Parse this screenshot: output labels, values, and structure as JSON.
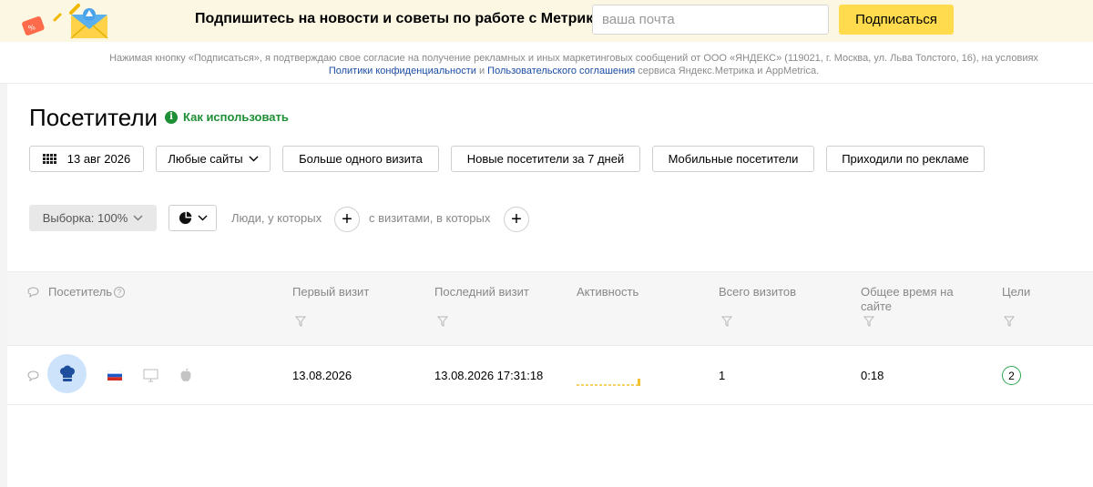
{
  "banner": {
    "title": "Подпишитесь на новости и советы по работе с Метрикой",
    "email_placeholder": "ваша почта",
    "subscribe_label": "Подписаться",
    "consent_line1": "Нажимая кнопку «Подписаться», я подтверждаю свое согласие на получение рекламных и иных маркетинговых сообщений от ООО «ЯНДЕКС» (119021, г. Москва, ул. Льва Толстого, 16), на условиях",
    "privacy_link": "Политики конфиденциальности",
    "and": "и",
    "user_agreement_link": "Пользовательского соглашения",
    "consent_line2_tail": "сервиса Яндекс.Метрика и AppMetrica."
  },
  "page": {
    "title": "Посетители",
    "howto_label": "Как использовать",
    "howto_icon": "i"
  },
  "filters": {
    "date_label": "13 авг 2026",
    "sites_label": "Любые сайты",
    "presets": [
      "Больше одного визита",
      "Новые посетители за 7 дней",
      "Мобильные посетители",
      "Приходили по рекламе"
    ]
  },
  "segment": {
    "sample_label": "Выборка: 100%",
    "people_label": "Люди, у которых",
    "visits_label": "с визитами, в которых",
    "plus": "+"
  },
  "table": {
    "headers": [
      "Посетитель",
      "Первый визит",
      "Последний визит",
      "Активность",
      "Всего визитов",
      "Общее время на сайте",
      "Цели"
    ],
    "help_icon": "?",
    "rows": [
      {
        "first_visit": "13.08.2026",
        "last_visit": "13.08.2026 17:31:18",
        "activity_level": 0.35,
        "total_visits": "1",
        "total_time": "0:18",
        "goals": "2"
      }
    ]
  },
  "colors": {
    "banner_bg": "#fcf7e3",
    "accent_yellow": "#ffdb4d",
    "green": "#1e8f35",
    "link_blue": "#1a4ca3",
    "avatar_bg": "#cde3fb",
    "activity_line": "#f2c230"
  },
  "icons": {
    "banner_art": "envelope-with-bell-icon",
    "calendar": "calendar-grid-icon",
    "chevron": "chevron-down-icon",
    "viz": "pie-chart-icon",
    "comment": "comment-icon",
    "filter": "filter-funnel-icon",
    "avatar": "chef-hat-icon",
    "flag": "russia-flag-icon",
    "device": "desktop-icon",
    "os": "apple-icon"
  }
}
